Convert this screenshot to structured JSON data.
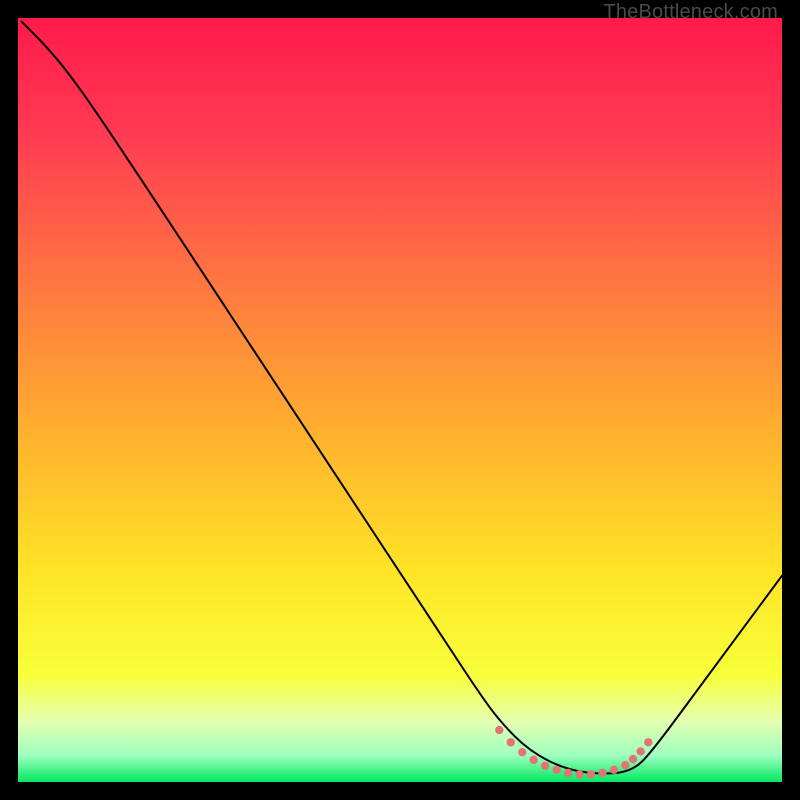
{
  "watermark": "TheBottleneck.com",
  "chart_data": {
    "type": "line",
    "title": "",
    "xlabel": "",
    "ylabel": "",
    "xlim": [
      0,
      100
    ],
    "ylim": [
      0,
      100
    ],
    "background_gradient": {
      "type": "vertical",
      "stops": [
        {
          "pos": 0.0,
          "color": "#ff1a4a"
        },
        {
          "pos": 0.15,
          "color": "#ff3a53"
        },
        {
          "pos": 0.35,
          "color": "#ff7840"
        },
        {
          "pos": 0.55,
          "color": "#ffb22e"
        },
        {
          "pos": 0.72,
          "color": "#ffe326"
        },
        {
          "pos": 0.86,
          "color": "#f8ff3a"
        },
        {
          "pos": 0.92,
          "color": "#e4ffb0"
        },
        {
          "pos": 0.965,
          "color": "#9fffc0"
        },
        {
          "pos": 1.0,
          "color": "#00e860"
        }
      ]
    },
    "series": [
      {
        "name": "bottleneck-curve",
        "stroke": "#000000",
        "stroke_width": 2,
        "x": [
          0.5,
          3.2,
          6.0,
          10.0,
          20.0,
          30.0,
          40.0,
          50.0,
          56.0,
          60.0,
          63.0,
          67.0,
          72.0,
          77.0,
          80.5,
          83.0,
          90.0,
          100.0
        ],
        "y": [
          99.5,
          96.8,
          93.6,
          88.1,
          73.0,
          57.8,
          42.6,
          27.4,
          18.3,
          12.2,
          8.0,
          4.0,
          1.5,
          1.0,
          1.5,
          4.0,
          13.5,
          27.0
        ]
      },
      {
        "name": "optimal-zone-markers",
        "type": "scatter",
        "color": "#e57373",
        "radius": 4.2,
        "points_x": [
          63.0,
          64.5,
          66.0,
          67.5,
          69.0,
          70.5,
          72.0,
          73.5,
          75.0,
          76.5,
          78.0,
          79.5,
          80.5,
          81.5,
          82.5
        ],
        "points_y": [
          6.8,
          5.2,
          3.9,
          2.9,
          2.1,
          1.6,
          1.2,
          1.0,
          1.0,
          1.2,
          1.6,
          2.2,
          3.0,
          4.0,
          5.2
        ]
      }
    ]
  }
}
